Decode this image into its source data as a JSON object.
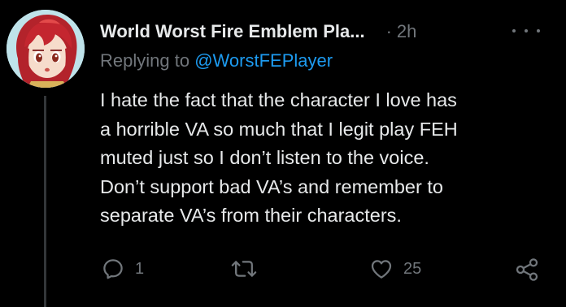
{
  "tweet": {
    "display_name": "World Worst Fire Emblem Pla...",
    "separator": "·",
    "timestamp": "2h",
    "replying_prefix": "Replying to",
    "replying_handle": "@WorstFEPlayer",
    "body_lines": [
      "I hate the fact that the character I love has",
      "a horrible VA so much that I legit play FEH",
      "muted just so I don’t listen to the voice.",
      "Don’t support bad VA’s and remember to",
      "separate VA’s from their characters."
    ]
  },
  "actions": {
    "reply": {
      "icon": "reply-icon",
      "count": "1"
    },
    "retweet": {
      "icon": "retweet-icon",
      "count": ""
    },
    "like": {
      "icon": "heart-icon",
      "count": "25"
    },
    "share": {
      "icon": "share-icon",
      "count": ""
    }
  },
  "colors": {
    "background": "#000000",
    "text_primary": "#e7e9ea",
    "text_secondary": "#71767b",
    "link": "#1d9bf0"
  }
}
